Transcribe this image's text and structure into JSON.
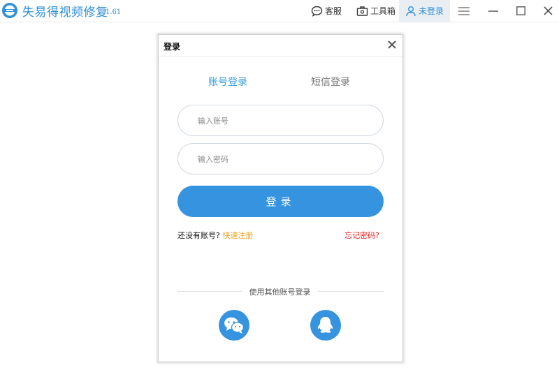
{
  "app": {
    "name": "失易得视频修复",
    "version": "1.61",
    "brand_color": "#2f8fd8",
    "icon": "app-logo-icon"
  },
  "titlebar": {
    "support_label": "客服",
    "support_icon": "chat-bubble-icon",
    "toolbox_label": "工具箱",
    "toolbox_icon": "toolbox-icon",
    "login_label": "未登录",
    "login_icon": "user-icon",
    "controls": [
      "menu-icon",
      "minimize-icon",
      "maximize-icon",
      "close-icon"
    ]
  },
  "dialog": {
    "title": "登录",
    "tabs": [
      {
        "label": "账号登录",
        "active": true
      },
      {
        "label": "短信登录",
        "active": false
      }
    ],
    "account_placeholder": "输入账号",
    "account_value": "",
    "password_placeholder": "输入密码",
    "password_value": "",
    "login_button": "登录",
    "no_account_text": "还没有账号?",
    "register_link": "快速注册",
    "forgot_link": "忘记密码?",
    "other_login_text": "使用其他账号登录",
    "social": [
      "wechat-icon",
      "qq-icon"
    ],
    "accent_color": "#3593e0",
    "register_color": "#f0a020",
    "forgot_color": "#e02020"
  }
}
